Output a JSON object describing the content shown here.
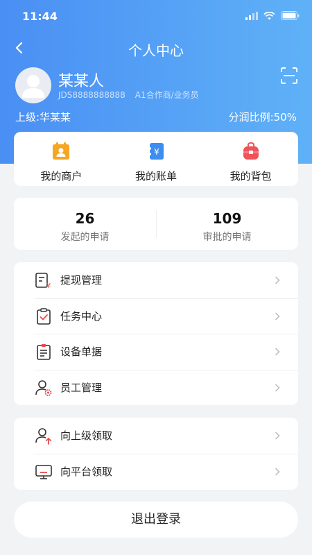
{
  "status_bar": {
    "time": "11:44",
    "icons": [
      "cellular-signal-icon",
      "wifi-icon",
      "battery-icon"
    ]
  },
  "header": {
    "title": "个人中心",
    "back_icon": "chevron-left-icon",
    "scan_icon": "scan-icon"
  },
  "profile": {
    "name": "某某人",
    "account_id": "JDS8888888888",
    "role": "A1合作商/业务员",
    "superior": "上级:华某某",
    "share_ratio": "分润比例:50%"
  },
  "shortcuts": [
    {
      "label": "我的商户",
      "icon": "merchant-icon",
      "color": "#f5a623"
    },
    {
      "label": "我的账单",
      "icon": "bill-icon",
      "color": "#3d8ef0"
    },
    {
      "label": "我的背包",
      "icon": "backpack-icon",
      "color": "#f0525a"
    }
  ],
  "stats": [
    {
      "value": "26",
      "label": "发起的申请"
    },
    {
      "value": "109",
      "label": "审批的申请"
    }
  ],
  "menu_group_1": [
    {
      "label": "提现管理",
      "icon": "withdraw-icon"
    },
    {
      "label": "任务中心",
      "icon": "task-clipboard-icon"
    },
    {
      "label": "设备单据",
      "icon": "device-document-icon"
    },
    {
      "label": "员工管理",
      "icon": "staff-settings-icon"
    }
  ],
  "menu_group_2": [
    {
      "label": "向上级领取",
      "icon": "receive-from-superior-icon"
    },
    {
      "label": "向平台领取",
      "icon": "receive-from-platform-icon"
    }
  ],
  "logout_label": "退出登录",
  "colors": {
    "header_start": "#4a8ff4",
    "header_end": "#5fb1f7",
    "accent_red": "#e84b4b",
    "background": "#f2f3f5"
  }
}
